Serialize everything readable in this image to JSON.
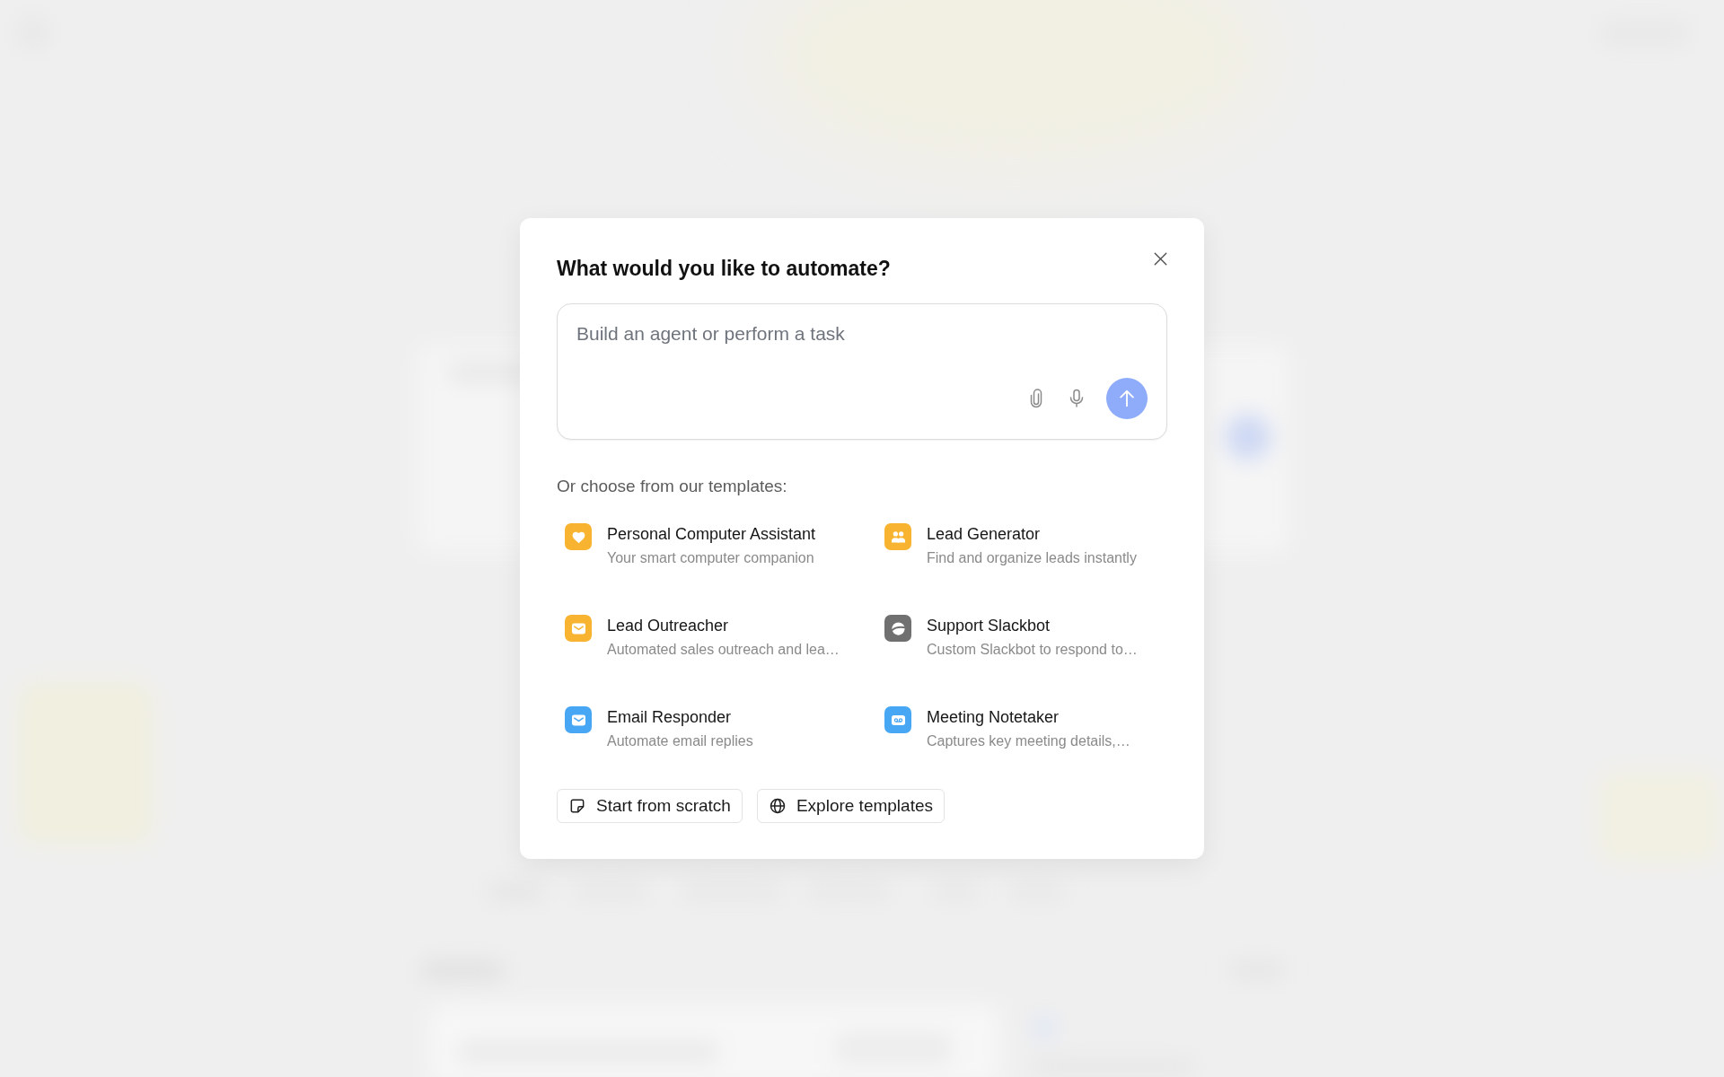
{
  "dialog": {
    "title": "What would you like to automate?"
  },
  "prompt": {
    "placeholder": "Build an agent or perform a task",
    "send_disabled": true
  },
  "templates_heading": "Or choose from our templates:",
  "templates": [
    {
      "title": "Personal Computer Assistant",
      "description": "Your smart computer companion",
      "kind": "heart",
      "color": "#f8b430"
    },
    {
      "title": "Lead Generator",
      "description": "Find and organize leads instantly",
      "kind": "people",
      "color": "#f8b430"
    },
    {
      "title": "Lead Outreacher",
      "description": "Automated sales outreach and lea…",
      "kind": "mail",
      "color": "#f8b430"
    },
    {
      "title": "Support Slackbot",
      "description": "Custom Slackbot to respond to…",
      "kind": "planet",
      "color": "#707070"
    },
    {
      "title": "Email Responder",
      "description": "Automate email replies",
      "kind": "mail",
      "color": "#48a7f4"
    },
    {
      "title": "Meeting Notetaker",
      "description": "Captures key meeting details,…",
      "kind": "voicemail",
      "color": "#48a7f4"
    }
  ],
  "actions": [
    {
      "label": "Start from scratch",
      "kind": "note"
    },
    {
      "label": "Explore templates",
      "kind": "globe"
    }
  ]
}
